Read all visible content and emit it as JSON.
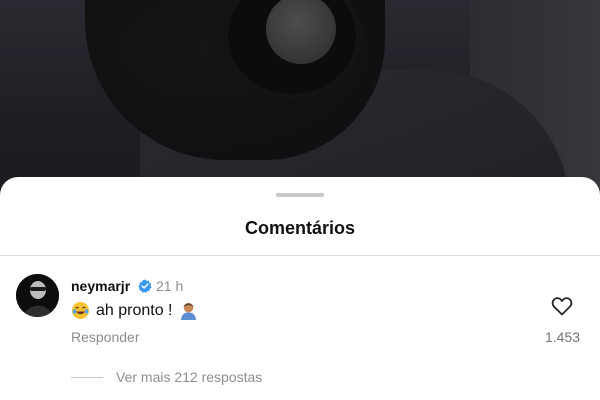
{
  "sheet": {
    "title": "Comentários"
  },
  "comment": {
    "username": "neymarjr",
    "verified": true,
    "time": "21 h",
    "text": "ah pronto !",
    "emojis": [
      "face-with-tears-of-joy-icon",
      "person-emoji-icon"
    ],
    "reply_label": "Responder",
    "likes": "1.453"
  },
  "replies": {
    "label": "Ver mais 212 respostas"
  },
  "colors": {
    "verified": "#3897f0",
    "secondary_text": "#8e8e8e",
    "primary_text": "#111111"
  }
}
